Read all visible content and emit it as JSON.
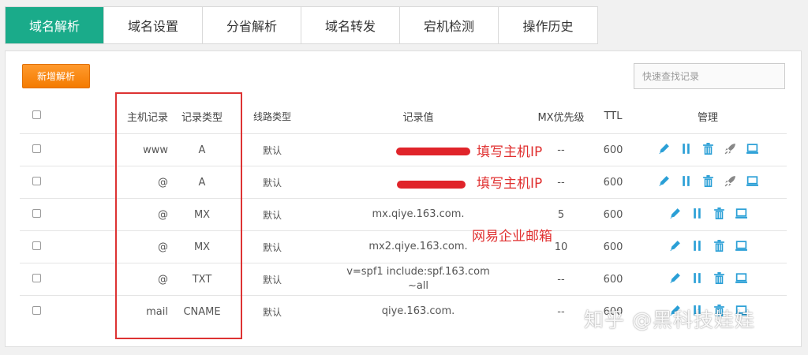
{
  "tabs": [
    {
      "label": "域名解析",
      "active": true
    },
    {
      "label": "域名设置"
    },
    {
      "label": "分省解析"
    },
    {
      "label": "域名转发"
    },
    {
      "label": "宕机检测"
    },
    {
      "label": "操作历史"
    }
  ],
  "toolbar": {
    "add_label": "新增解析",
    "search_placeholder": "快速查找记录"
  },
  "table": {
    "headers": {
      "host": "主机记录",
      "type": "记录类型",
      "line": "线路类型",
      "value": "记录值",
      "mx": "MX优先级",
      "ttl": "TTL",
      "manage": "管理"
    },
    "rows": [
      {
        "host": "www",
        "type": "A",
        "line": "默认",
        "value": "",
        "mx": "--",
        "ttl": "600"
      },
      {
        "host": "@",
        "type": "A",
        "line": "默认",
        "value": "",
        "mx": "--",
        "ttl": "600"
      },
      {
        "host": "@",
        "type": "MX",
        "line": "默认",
        "value": "mx.qiye.163.com.",
        "mx": "5",
        "ttl": "600"
      },
      {
        "host": "@",
        "type": "MX",
        "line": "默认",
        "value": "mx2.qiye.163.com.",
        "mx": "10",
        "ttl": "600"
      },
      {
        "host": "@",
        "type": "TXT",
        "line": "默认",
        "value": "v=spf1 include:spf.163.com",
        "value2": "~all",
        "mx": "--",
        "ttl": "600"
      },
      {
        "host": "mail",
        "type": "CNAME",
        "line": "默认",
        "value": "qiye.163.com.",
        "mx": "--",
        "ttl": "600"
      }
    ]
  },
  "annotations": {
    "fill_ip_1": "填写主机IP",
    "fill_ip_2": "填写主机IP",
    "netease_mail": "网易企业邮箱"
  },
  "watermark": "知乎 @黑科技娃娃",
  "colors": {
    "tab_active": "#1aab8a",
    "add_button": "#f47b00",
    "icon": "#2a9fd6",
    "annotation": "#e03030"
  }
}
